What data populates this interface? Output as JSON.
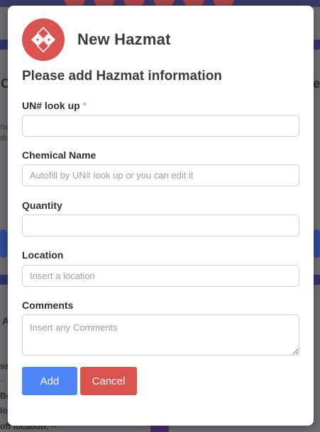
{
  "background": {
    "text_fragments": [
      "C",
      "ne",
      "du",
      "e",
      "Ac",
      "ss",
      "-",
      "Bo",
      "lo",
      "off location: --"
    ]
  },
  "modal": {
    "title": "New Hazmat",
    "subtitle": "Please add Hazmat information",
    "logo_icon": "hazmat-diamond-icon",
    "fields": {
      "un_lookup": {
        "label": "UN# look up",
        "required_mark": "*",
        "value": "",
        "placeholder": ""
      },
      "chemical_name": {
        "label": "Chemical Name",
        "value": "",
        "placeholder": "Autofill by UN# look up or you can edit it"
      },
      "quantity": {
        "label": "Quantity",
        "value": "",
        "placeholder": ""
      },
      "location": {
        "label": "Location",
        "value": "",
        "placeholder": "Insert a location"
      },
      "comments": {
        "label": "Comments",
        "value": "",
        "placeholder": "Insert any Comments"
      }
    },
    "buttons": {
      "add_label": "Add",
      "cancel_label": "Cancel"
    }
  },
  "colors": {
    "accent_red": "#d9534f",
    "primary_blue": "#4f86f7"
  }
}
